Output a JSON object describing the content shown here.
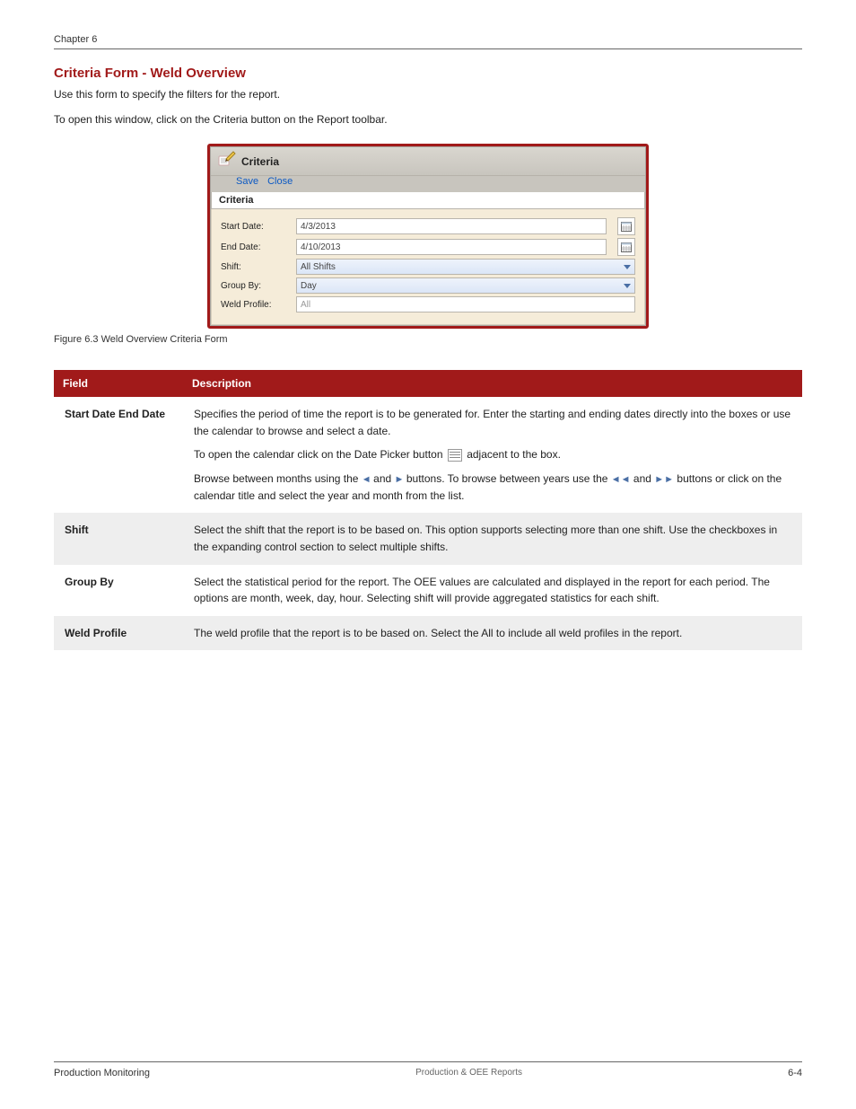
{
  "header": {
    "chapter": "Chapter 6"
  },
  "section_title": "Criteria Form - Weld Overview",
  "intro": [
    "Use this form to specify the filters for the report.",
    "To open this window, click on the Criteria button on the Report toolbar."
  ],
  "dialog": {
    "title": "Criteria",
    "links": {
      "save": "Save",
      "close": "Close"
    },
    "section": "Criteria",
    "fields": {
      "start_date": {
        "label": "Start Date:",
        "value": "4/3/2013"
      },
      "end_date": {
        "label": "End Date:",
        "value": "4/10/2013"
      },
      "shift": {
        "label": "Shift:",
        "value": "All Shifts"
      },
      "group_by": {
        "label": "Group By:",
        "value": "Day"
      },
      "weld_profile": {
        "label": "Weld Profile:",
        "value": "All"
      }
    }
  },
  "figure_caption": "Figure 6.3 Weld Overview Criteria Form",
  "table": {
    "headers": {
      "field": "Field",
      "desc": "Description"
    },
    "rows": [
      {
        "label": "Start Date End Date",
        "desc_lines": [
          "Specifies the period of time the report is to be generated for. Enter the starting and ending dates directly into the boxes or use the calendar to browse and select a date.",
          "To open the calendar click on the Date Picker button",
          "adjacent to the box.",
          "Browse between months using the",
          "and",
          "buttons. To browse between years use the",
          "and",
          "buttons or click on the calendar title and select the year and month from the list."
        ]
      },
      {
        "label": "Shift",
        "desc": "Select the shift that the report is to be based on. This option supports selecting more than one shift. Use the checkboxes in the expanding control section to select multiple shifts."
      },
      {
        "label": "Group By",
        "desc": "Select the statistical period for the report. The OEE values are calculated and displayed in the report for each period. The options are month, week, day, hour. Selecting shift will provide aggregated statistics for each shift."
      },
      {
        "label": "Weld Profile",
        "desc": "The weld profile that the report is to be based on. Select the All to include all weld profiles in the report."
      }
    ]
  },
  "footer": {
    "left": "Production Monitoring",
    "mid": "Production & OEE Reports",
    "right": "6-4"
  }
}
